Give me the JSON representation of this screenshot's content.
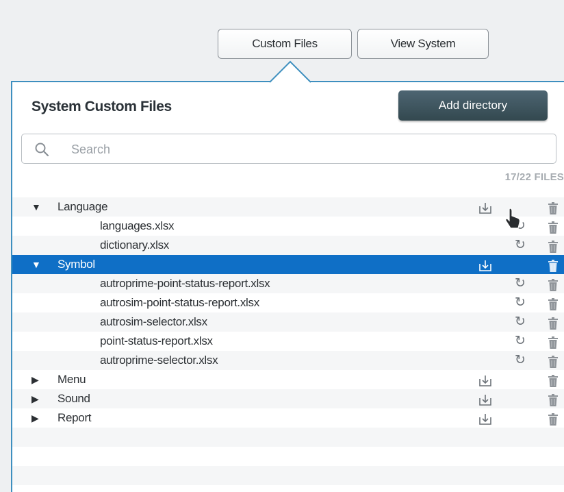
{
  "header": {
    "custom_files_label": "Custom Files",
    "view_system_label": "View System"
  },
  "panel": {
    "title": "System Custom Files",
    "add_directory_label": "Add directory",
    "search_placeholder": "Search",
    "file_count": "17/22 FILES"
  },
  "tree": [
    {
      "type": "dir",
      "name": "Language",
      "expanded": true,
      "selected": false
    },
    {
      "type": "file",
      "name": "languages.xlsx"
    },
    {
      "type": "file",
      "name": "dictionary.xlsx"
    },
    {
      "type": "dir",
      "name": "Symbol",
      "expanded": true,
      "selected": true
    },
    {
      "type": "file",
      "name": "autroprime-point-status-report.xlsx"
    },
    {
      "type": "file",
      "name": "autrosim-point-status-report.xlsx"
    },
    {
      "type": "file",
      "name": "autrosim-selector.xlsx"
    },
    {
      "type": "file",
      "name": "point-status-report.xlsx"
    },
    {
      "type": "file",
      "name": "autroprime-selector.xlsx"
    },
    {
      "type": "dir",
      "name": "Menu",
      "expanded": false,
      "selected": false
    },
    {
      "type": "dir",
      "name": "Sound",
      "expanded": false,
      "selected": false
    },
    {
      "type": "dir",
      "name": "Report",
      "expanded": false,
      "selected": false
    }
  ],
  "colors": {
    "accent": "#0f6fc6",
    "panel_border": "#3e8fbf",
    "button_dark": "#3d535d"
  },
  "icons": {
    "expanded": "triangle-down-icon",
    "collapsed": "triangle-right-icon",
    "download": "download-icon",
    "reload": "reload-icon",
    "trash": "trash-icon",
    "search": "search-icon"
  }
}
